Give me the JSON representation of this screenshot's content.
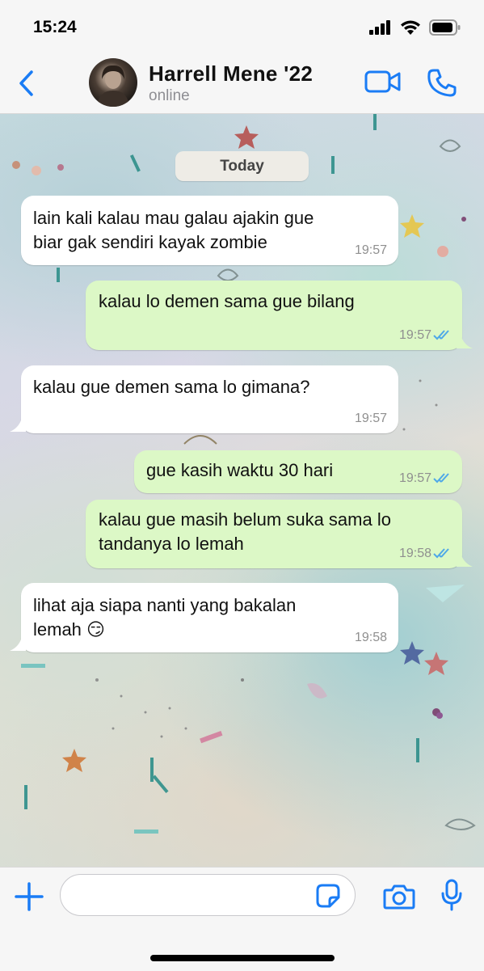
{
  "status_bar": {
    "time": "15:24"
  },
  "header": {
    "back_icon": "chevron-left-icon",
    "contact_name": "Harrell Mene '22",
    "contact_status": "online",
    "video_icon": "video-call-icon",
    "call_icon": "phone-icon"
  },
  "chat": {
    "date_label": "Today",
    "messages": [
      {
        "direction": "incoming",
        "text": "lain kali kalau mau galau ajakin gue\nbiar gak sendiri kayak zombie",
        "time": "19:57"
      },
      {
        "direction": "outgoing",
        "text": "kalau lo demen sama gue bilang",
        "time": "19:57",
        "status": "read"
      },
      {
        "direction": "incoming",
        "text": "kalau gue demen sama lo gimana?",
        "time": "19:57"
      },
      {
        "direction": "outgoing",
        "text": "gue kasih waktu 30 hari",
        "time": "19:57",
        "status": "read"
      },
      {
        "direction": "outgoing",
        "text": "kalau gue masih belum suka sama lo\ntandanya lo lemah",
        "time": "19:58",
        "status": "read"
      },
      {
        "direction": "incoming",
        "text": "lihat aja siapa nanti yang bakalan\nlemah 😏",
        "time": "19:58"
      }
    ]
  },
  "input_bar": {
    "plus_icon": "plus-icon",
    "placeholder": "",
    "sticker_icon": "sticker-icon",
    "camera_icon": "camera-icon",
    "mic_icon": "microphone-icon"
  },
  "colors": {
    "accent": "#1a7cf5",
    "outgoing_bubble": "#dcf8c6",
    "incoming_bubble": "#ffffff",
    "read_ticks": "#4fa8e8"
  }
}
